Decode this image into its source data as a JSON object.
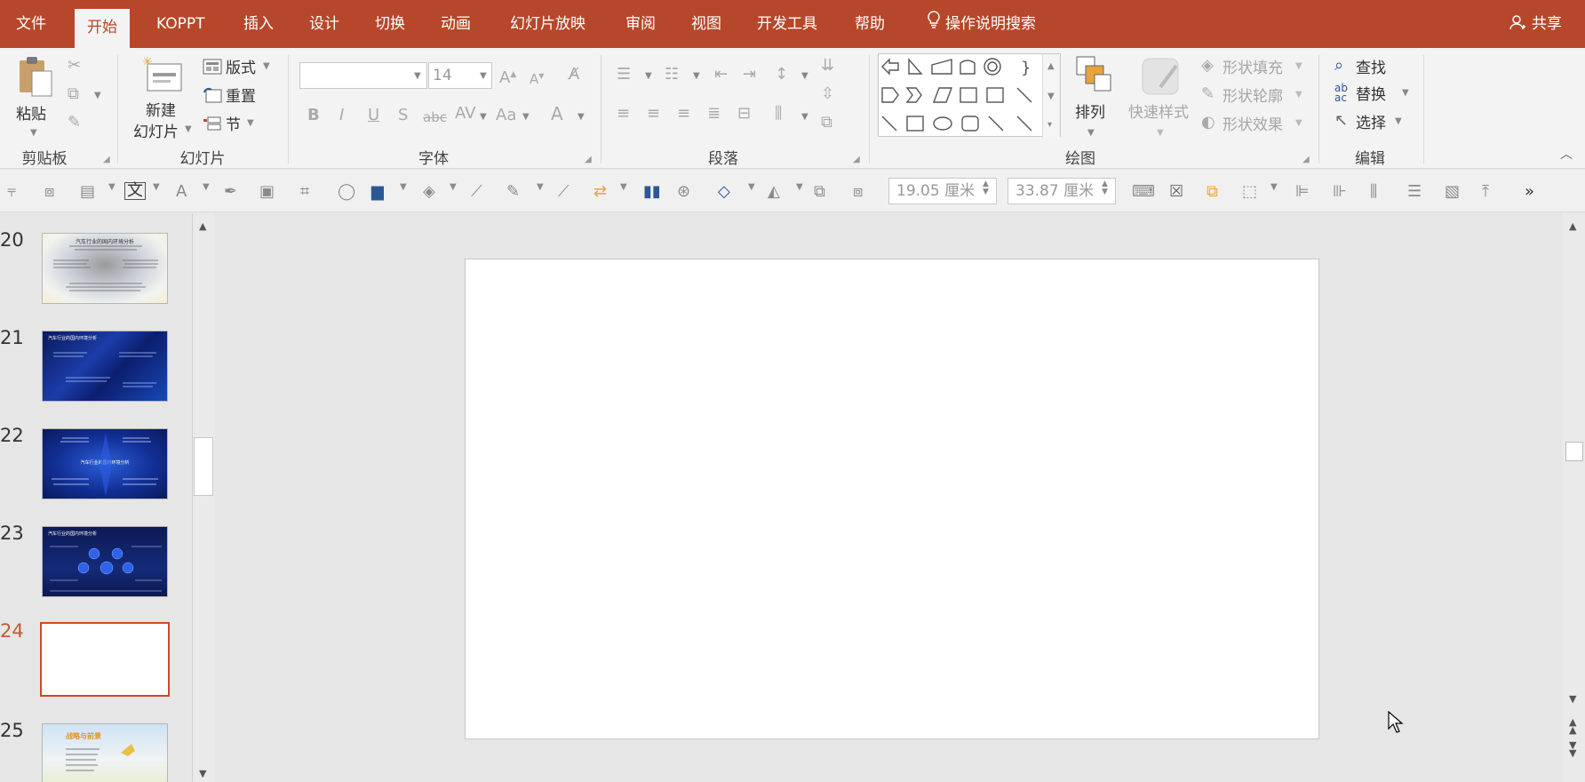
{
  "menu": {
    "file": "文件",
    "home": "开始",
    "koppt": "KOPPT",
    "insert": "插入",
    "design": "设计",
    "transitions": "切换",
    "animations": "动画",
    "slideshow": "幻灯片放映",
    "review": "审阅",
    "view": "视图",
    "developer": "开发工具",
    "help": "帮助",
    "tell_me": "操作说明搜索",
    "share": "共享"
  },
  "ribbon": {
    "clipboard": {
      "paste": "粘贴",
      "group": "剪贴板"
    },
    "slides": {
      "new_slide_line1": "新建",
      "new_slide_line2": "幻灯片",
      "layout": "版式",
      "reset": "重置",
      "section": "节",
      "group": "幻灯片"
    },
    "font": {
      "font_name": "",
      "font_size": "14",
      "group": "字体"
    },
    "paragraph": {
      "group": "段落"
    },
    "drawing": {
      "arrange": "排列",
      "quick_styles": "快速样式",
      "shape_fill": "形状填充",
      "shape_outline": "形状轮廓",
      "shape_effects": "形状效果",
      "group": "绘图"
    },
    "editing": {
      "find": "查找",
      "replace": "替换",
      "select": "选择",
      "group": "编辑"
    }
  },
  "toolbar2": {
    "height_value": "19.05 厘米",
    "width_value": "33.87 厘米"
  },
  "slides": [
    {
      "number": "20",
      "title": "汽车行业的国内环境分析",
      "theme": "light"
    },
    {
      "number": "21",
      "title": "汽车行业的国内环境分析",
      "theme": "dark"
    },
    {
      "number": "22",
      "title": "汽车行业的国内环境分析",
      "theme": "dark"
    },
    {
      "number": "23",
      "title": "汽车行业的国内环境分析",
      "theme": "dark"
    },
    {
      "number": "24",
      "title": "",
      "theme": "blank"
    },
    {
      "number": "25",
      "title": "战略与前景",
      "theme": "light"
    }
  ],
  "colors": {
    "accent": "#b7472a",
    "selection": "#d24726",
    "slide_number_active": "#c55a35"
  }
}
